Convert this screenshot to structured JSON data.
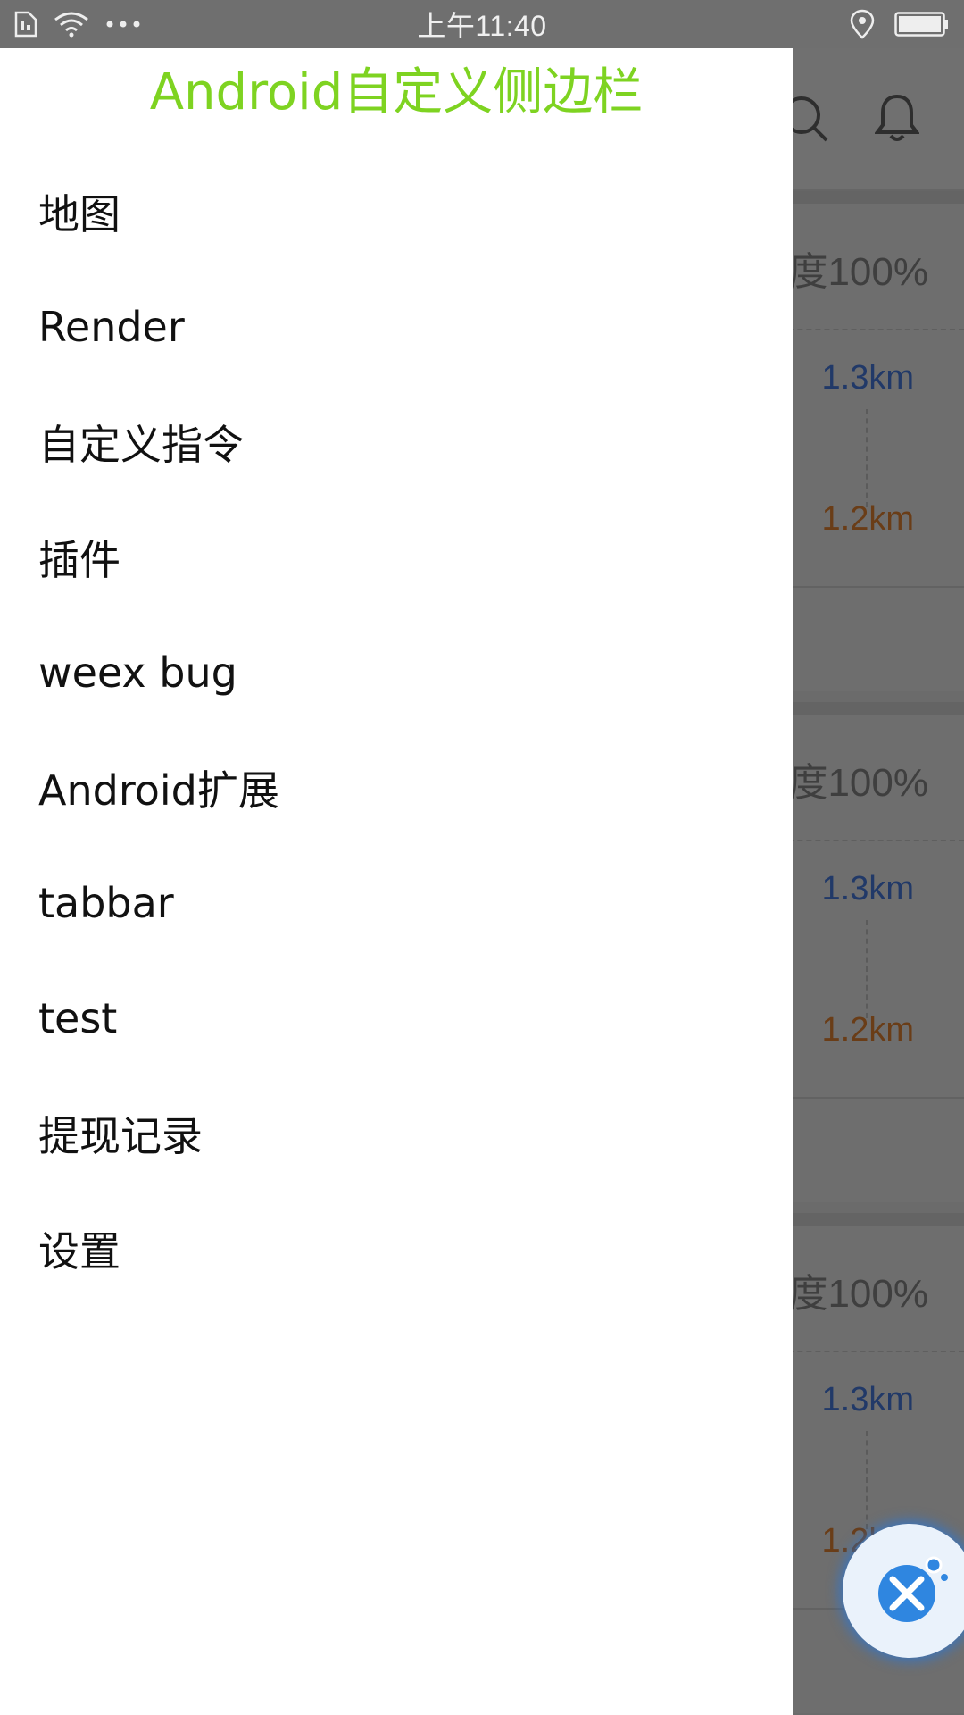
{
  "status_bar": {
    "time": "上午11:40",
    "icons": [
      "sim-icon",
      "wifi-icon",
      "more-dots-icon",
      "location-icon",
      "battery-icon"
    ]
  },
  "drawer": {
    "title": "Android自定义侧边栏",
    "title_color": "#7ed321",
    "items": [
      {
        "label": "地图"
      },
      {
        "label": "Render"
      },
      {
        "label": "自定义指令"
      },
      {
        "label": "插件"
      },
      {
        "label": "weex bug"
      },
      {
        "label": "Android扩展"
      },
      {
        "label": "tabbar"
      },
      {
        "label": "test"
      },
      {
        "label": "提现记录"
      },
      {
        "label": "设置"
      }
    ]
  },
  "background": {
    "header_icons": [
      "search-icon",
      "bell-icon"
    ],
    "cards": [
      {
        "rate": "度100%",
        "distance_top": "1.3km",
        "distance_bottom": "1.2km"
      },
      {
        "rate": "度100%",
        "distance_top": "1.3km",
        "distance_bottom": "1.2km"
      },
      {
        "rate": "度100%",
        "distance_top": "1.3km",
        "distance_bottom": "1.2km"
      }
    ],
    "colors": {
      "overlay": "#6b6b6b",
      "distance_top": "#213968",
      "distance_bottom": "#6a3d17"
    }
  },
  "fab": {
    "icon": "tools-icon",
    "glow_color": "#2878dc"
  }
}
